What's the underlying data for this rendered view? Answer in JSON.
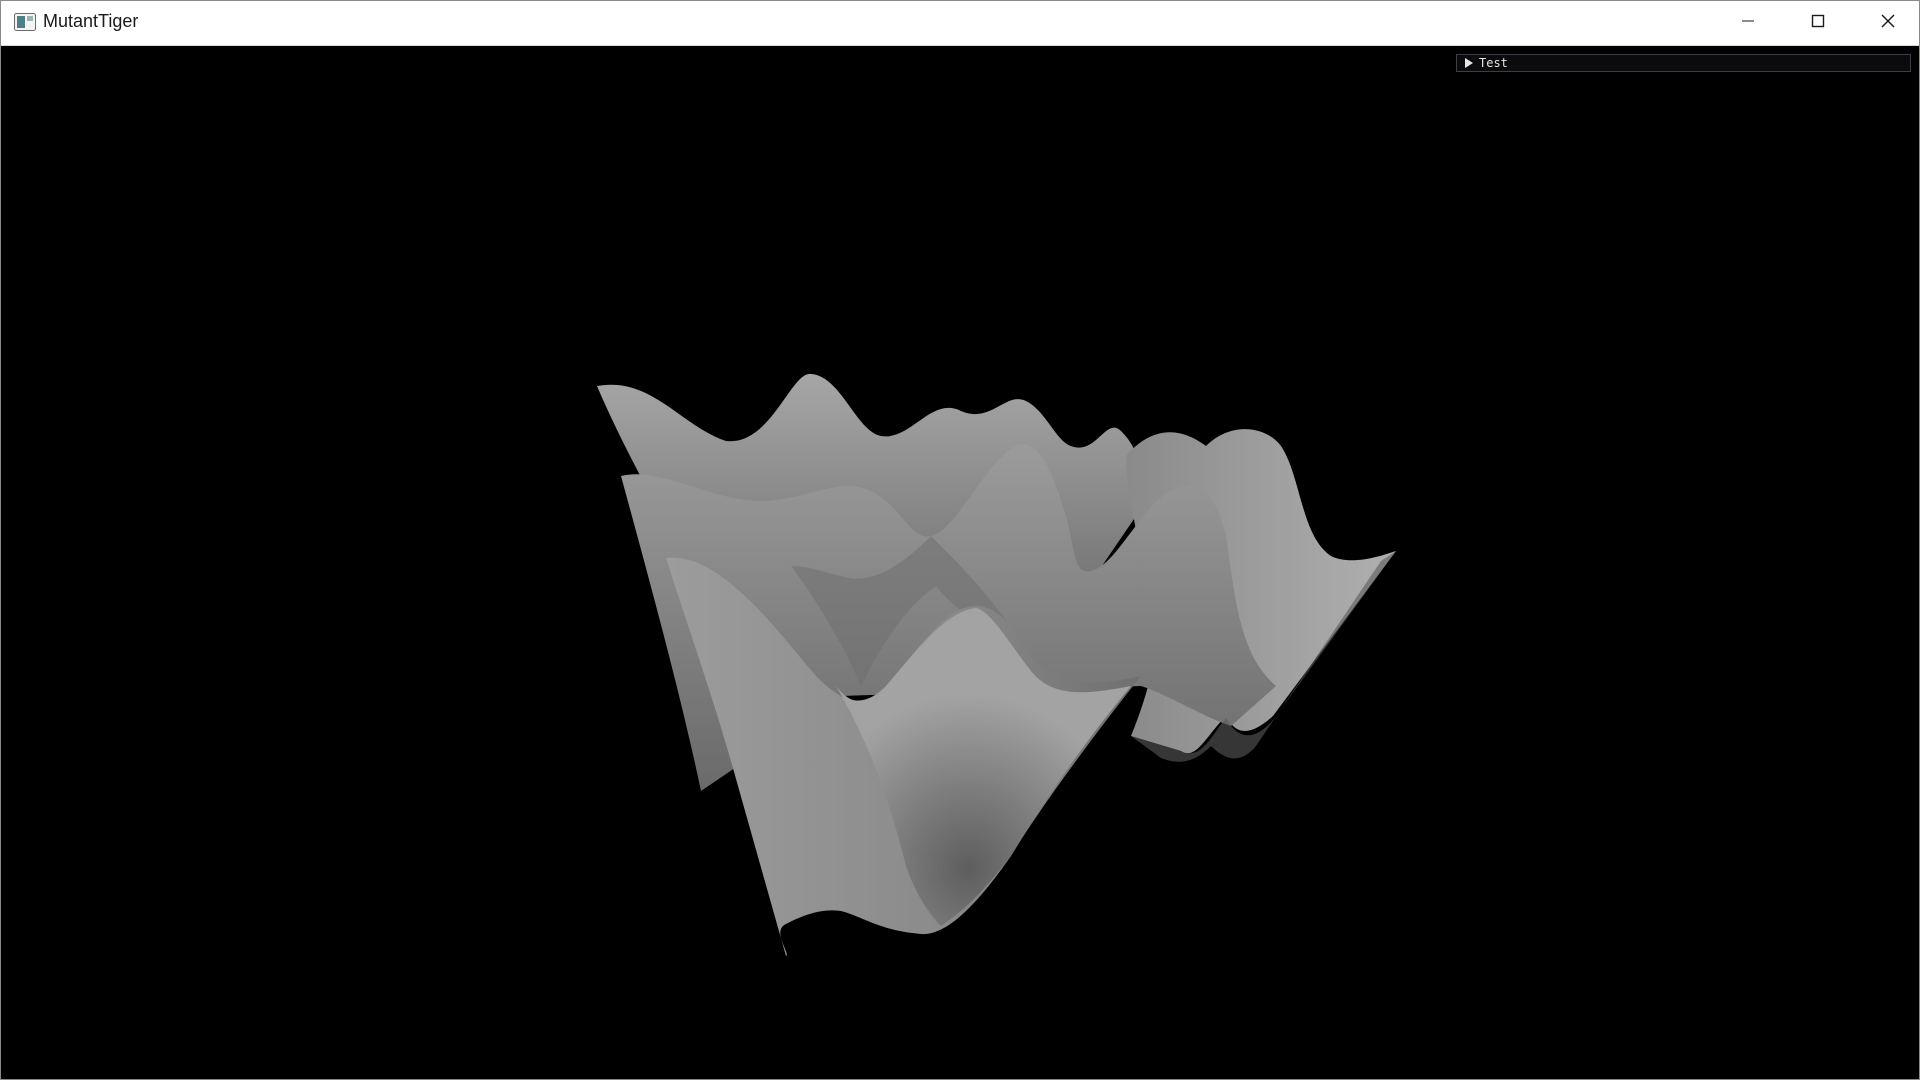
{
  "window": {
    "title": "MutantTiger",
    "app_icon": "app-window-icon",
    "controls": {
      "minimize_icon": "minimize-icon",
      "maximize_icon": "maximize-icon",
      "close_icon": "close-icon"
    }
  },
  "viewport": {
    "background": "#000000",
    "surface_color": "#9a9a9a"
  },
  "imgui": {
    "panel_title": "Test",
    "collapsed": true,
    "arrow_icon": "collapse-arrow-icon"
  }
}
